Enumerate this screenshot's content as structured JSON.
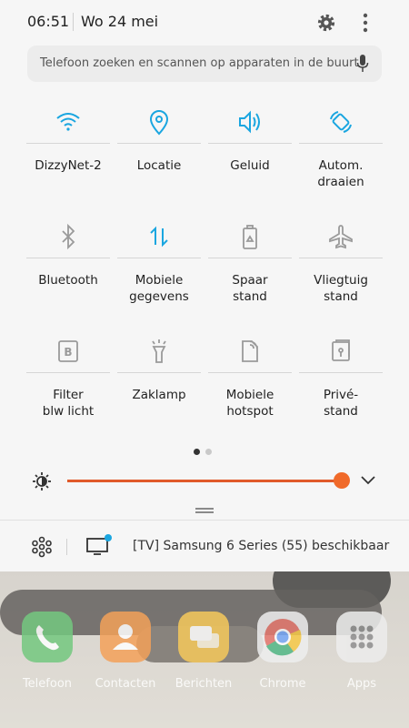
{
  "status": {
    "time": "06:51",
    "date": "Wo 24 mei"
  },
  "search": {
    "placeholder": "Telefoon zoeken en scannen op apparaten in de buurt"
  },
  "tiles": [
    {
      "label": "DizzyNet-2",
      "icon": "wifi-icon",
      "active": true
    },
    {
      "label": "Locatie",
      "icon": "location-icon",
      "active": true
    },
    {
      "label": "Geluid",
      "icon": "sound-icon",
      "active": true
    },
    {
      "label": "Autom.\ndraaien",
      "icon": "auto-rotate-icon",
      "active": true
    },
    {
      "label": "Bluetooth",
      "icon": "bluetooth-icon",
      "active": false
    },
    {
      "label": "Mobiele\ngegevens",
      "icon": "mobile-data-icon",
      "active": true
    },
    {
      "label": "Spaar\nstand",
      "icon": "power-saving-icon",
      "active": false
    },
    {
      "label": "Vliegtuig\nstand",
      "icon": "airplane-icon",
      "active": false
    },
    {
      "label": "Filter\nblw licht",
      "icon": "blue-light-filter-icon",
      "active": false
    },
    {
      "label": "Zaklamp",
      "icon": "flashlight-icon",
      "active": false
    },
    {
      "label": "Mobiele\nhotspot",
      "icon": "hotspot-icon",
      "active": false
    },
    {
      "label": "Privé-\nstand",
      "icon": "private-mode-icon",
      "active": false
    }
  ],
  "pager": {
    "current": 1,
    "total": 2
  },
  "brightness": {
    "level": 0.99
  },
  "notification": {
    "text": "[TV] Samsung 6 Series (55) beschikbaar"
  },
  "dock": [
    {
      "label": "Telefoon",
      "icon": "phone-icon",
      "color": "#3fb34f"
    },
    {
      "label": "Contacten",
      "icon": "contacts-icon",
      "color": "#ef7d1a"
    },
    {
      "label": "Berichten",
      "icon": "messages-icon",
      "color": "#f3b51d"
    },
    {
      "label": "Chrome",
      "icon": "chrome-icon",
      "color": "#e8e8e8"
    },
    {
      "label": "Apps",
      "icon": "apps-icon",
      "color": "#e6e6e6"
    }
  ],
  "colors": {
    "accent": "#1aa6e0",
    "inactive": "#9a9a9a",
    "slider": "#f06a2a"
  }
}
